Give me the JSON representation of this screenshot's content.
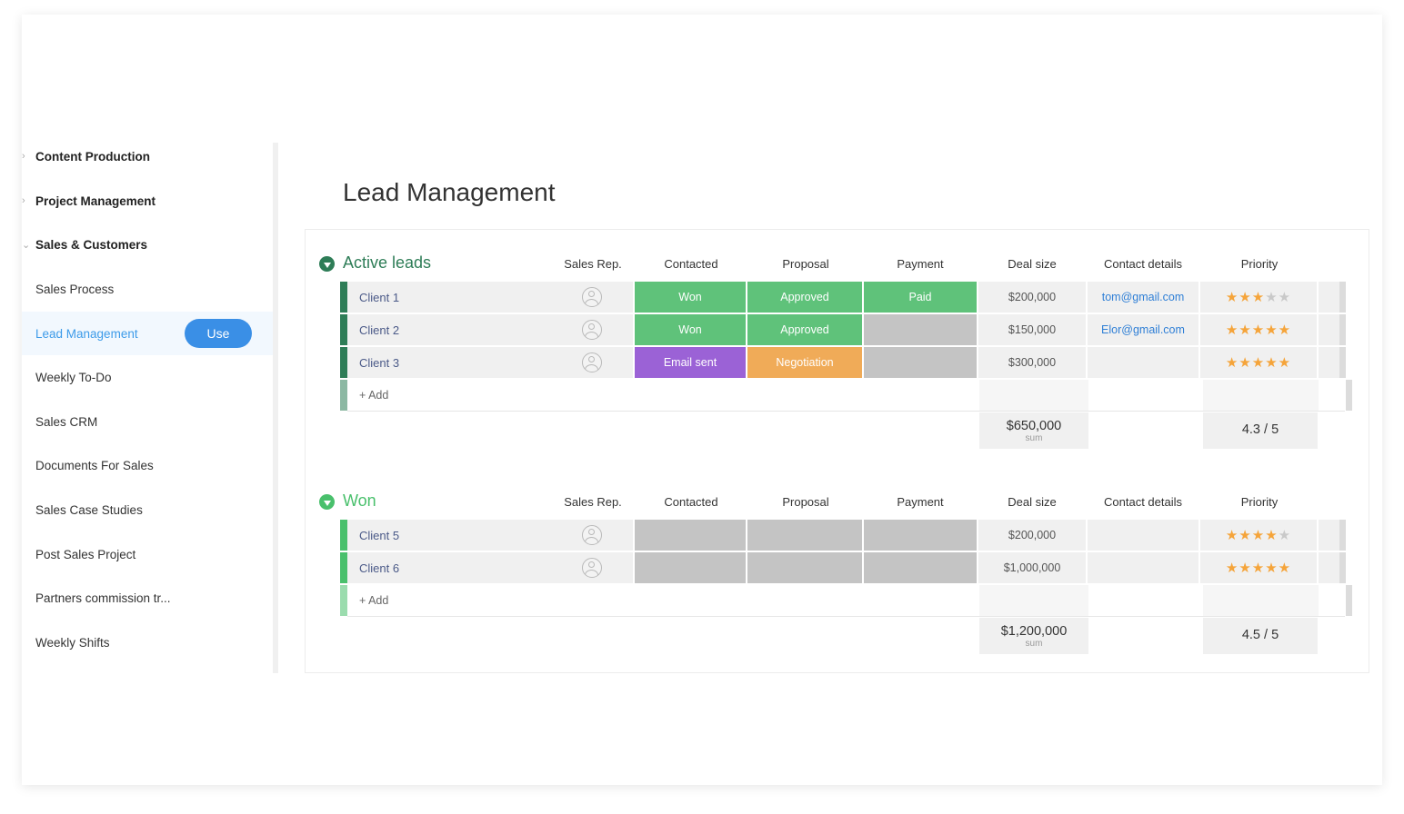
{
  "sidebar": {
    "categories": [
      {
        "label": "Content Production",
        "chevron": "›"
      },
      {
        "label": "Project Management",
        "chevron": "›"
      },
      {
        "label": "Sales & Customers",
        "chevron": "⌄"
      }
    ],
    "items": [
      {
        "label": "Sales Process"
      },
      {
        "label": "Lead Management"
      },
      {
        "label": "Weekly To-Do"
      },
      {
        "label": "Sales CRM"
      },
      {
        "label": "Documents For Sales"
      },
      {
        "label": "Sales Case Studies"
      },
      {
        "label": "Post Sales Project"
      },
      {
        "label": "Partners commission tr..."
      },
      {
        "label": "Weekly Shifts"
      }
    ],
    "active_index": 1,
    "use_button": "Use"
  },
  "main": {
    "title": "Lead Management",
    "columns": [
      "Sales Rep.",
      "Contacted",
      "Proposal",
      "Payment",
      "Deal size",
      "Contact details",
      "Priority"
    ],
    "groups": [
      {
        "title": "Active leads",
        "color": "#2e7d57",
        "rows": [
          {
            "name": "Client 1",
            "contacted": "Won",
            "proposal": "Approved",
            "payment": "Paid",
            "deal": "$200,000",
            "contact": "tom@gmail.com",
            "stars": 3
          },
          {
            "name": "Client 2",
            "contacted": "Won",
            "proposal": "Approved",
            "payment": "",
            "deal": "$150,000",
            "contact": "Elor@gmail.com",
            "stars": 5
          },
          {
            "name": "Client 3",
            "contacted": "Email sent",
            "proposal": "Negotiation",
            "payment": "",
            "deal": "$300,000",
            "contact": "",
            "stars": 5
          }
        ],
        "add_label": "+ Add",
        "sum_value": "$650,000",
        "sum_label": "sum",
        "priority_avg": "4.3 / 5"
      },
      {
        "title": "Won",
        "color": "#49c06c",
        "rows": [
          {
            "name": "Client 5",
            "contacted": "",
            "proposal": "",
            "payment": "",
            "deal": "$200,000",
            "contact": "",
            "stars": 4
          },
          {
            "name": "Client 6",
            "contacted": "",
            "proposal": "",
            "payment": "",
            "deal": "$1,000,000",
            "contact": "",
            "stars": 5
          }
        ],
        "add_label": "+ Add",
        "sum_value": "$1,200,000",
        "sum_label": "sum",
        "priority_avg": "4.5 / 5"
      }
    ],
    "status_colors": {
      "Won": "#5fc27a",
      "Approved": "#5fc27a",
      "Paid": "#5fc27a",
      "Email sent": "#9b62d6",
      "Negotiation": "#f0ab58",
      "": "#c4c4c4"
    },
    "link_color": "#2f7fd6"
  }
}
